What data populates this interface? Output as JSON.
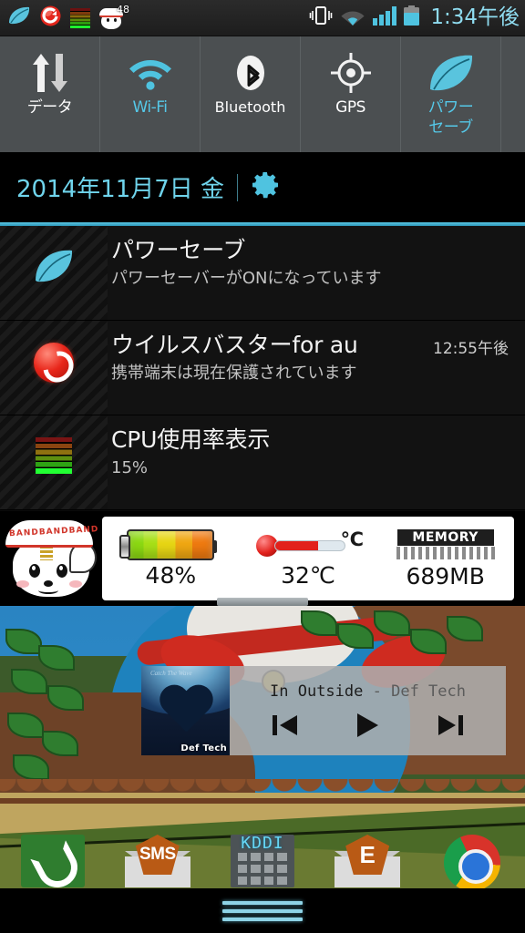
{
  "status_bar": {
    "time": "1:34午後",
    "left_icons": [
      {
        "name": "power-save-leaf-icon",
        "label": "パワーセーブ"
      },
      {
        "name": "virus-buster-icon",
        "label": "ウイルスバスター"
      },
      {
        "name": "cpu-meter-icon",
        "label": "CPU使用率表示"
      },
      {
        "name": "mascot-app-icon",
        "label": "マスコット",
        "badge": "48"
      }
    ],
    "right_icons": [
      {
        "name": "vibrate-icon"
      },
      {
        "name": "wifi-icon"
      },
      {
        "name": "signal-icon"
      },
      {
        "name": "battery-icon"
      }
    ]
  },
  "quick_settings": {
    "tiles": [
      {
        "label": "データ",
        "icon": "data-transfer-icon",
        "state": "off"
      },
      {
        "label": "Wi-Fi",
        "icon": "wifi-icon",
        "state": "on"
      },
      {
        "label": "Bluetooth",
        "icon": "bluetooth-icon",
        "state": "off"
      },
      {
        "label": "GPS",
        "icon": "gps-icon",
        "state": "off"
      },
      {
        "label": "パワー",
        "label2": "セーブ",
        "icon": "leaf-icon",
        "state": "on"
      }
    ]
  },
  "date_row": {
    "date": "2014年11月7日  金",
    "settings_icon": "gear-icon"
  },
  "notifications": [
    {
      "icon": "leaf-icon",
      "title": "パワーセーブ",
      "subtitle": "パワーセーバーがONになっています",
      "time": ""
    },
    {
      "icon": "virus-buster-icon",
      "title": "ウイルスバスターfor au",
      "subtitle": "携帯端末は現在保護されています",
      "time": "12:55午後"
    },
    {
      "icon": "cpu-meter-icon",
      "title": "CPU使用率表示",
      "subtitle": "15%",
      "time": ""
    }
  ],
  "widget_strip": {
    "mascot_band_text": "BANDBANDBAND",
    "cells": [
      {
        "icon": "battery-icon",
        "value": "48%"
      },
      {
        "icon": "thermometer-icon",
        "value": "32℃",
        "unit_glyph": "℃"
      },
      {
        "icon": "memory-chip-icon",
        "value": "689MB",
        "chip_label": "MEMORY"
      }
    ]
  },
  "music_widget": {
    "album_art_label": "Def Tech",
    "album_art_top": "Catch The Wave",
    "track": "In Outside",
    "separator": " - ",
    "artist": "Def Tech",
    "controls": [
      {
        "name": "previous-track-button"
      },
      {
        "name": "play-button"
      },
      {
        "name": "next-track-button"
      }
    ]
  },
  "dock": {
    "items": [
      {
        "name": "phone-app-icon",
        "label": ""
      },
      {
        "name": "sms-app-icon",
        "label": "SMS"
      },
      {
        "name": "kddi-dialer-app-icon",
        "label": "KDDI"
      },
      {
        "name": "email-app-icon",
        "label": "E"
      },
      {
        "name": "chrome-app-icon",
        "label": ""
      }
    ]
  },
  "nav_bar": {
    "menu_icon": "menu-lines-icon"
  },
  "colors": {
    "accent_cyan": "#6fd4ec",
    "quick_settings_bg": "#4b4f51",
    "shade_bg": "#0a0a0a",
    "notification_bg": "#121212"
  }
}
